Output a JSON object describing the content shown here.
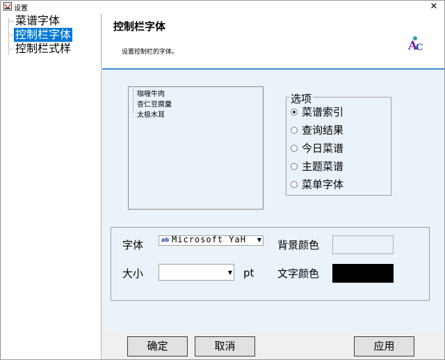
{
  "window": {
    "title": "设置",
    "close_glyph": "✕"
  },
  "tree": {
    "items": [
      {
        "label": "菜谱字体",
        "selected": false
      },
      {
        "label": "控制栏字体",
        "selected": true
      },
      {
        "label": "控制栏式样",
        "selected": false
      }
    ]
  },
  "header": {
    "title": "控制栏字体",
    "subtitle": "设置控制栏的字体。",
    "icon": "font-ac-icon"
  },
  "preview_list": {
    "items": [
      "咖喱牛肉",
      "杏仁豆腐羹",
      "太极木耳"
    ]
  },
  "options": {
    "legend": "选项",
    "items": [
      {
        "label": "菜谱索引",
        "checked": true
      },
      {
        "label": "查询结果",
        "checked": false
      },
      {
        "label": "今日菜谱",
        "checked": false
      },
      {
        "label": "主题菜谱",
        "checked": false
      },
      {
        "label": "菜单字体",
        "checked": false
      }
    ]
  },
  "font_settings": {
    "font_label": "字体",
    "font_value": "Microsoft YaH",
    "size_label": "大小",
    "size_value": "",
    "size_unit": "pt",
    "bg_color_label": "背景颜色",
    "bg_color": "#eaf3fa",
    "text_color_label": "文字颜色",
    "text_color": "#000000"
  },
  "buttons": {
    "ok": "确定",
    "cancel": "取消",
    "apply": "应用"
  },
  "colors": {
    "selection": "#0078d7",
    "header_border": "#3a8ed8",
    "panel_bg": "#eaf3fa"
  }
}
